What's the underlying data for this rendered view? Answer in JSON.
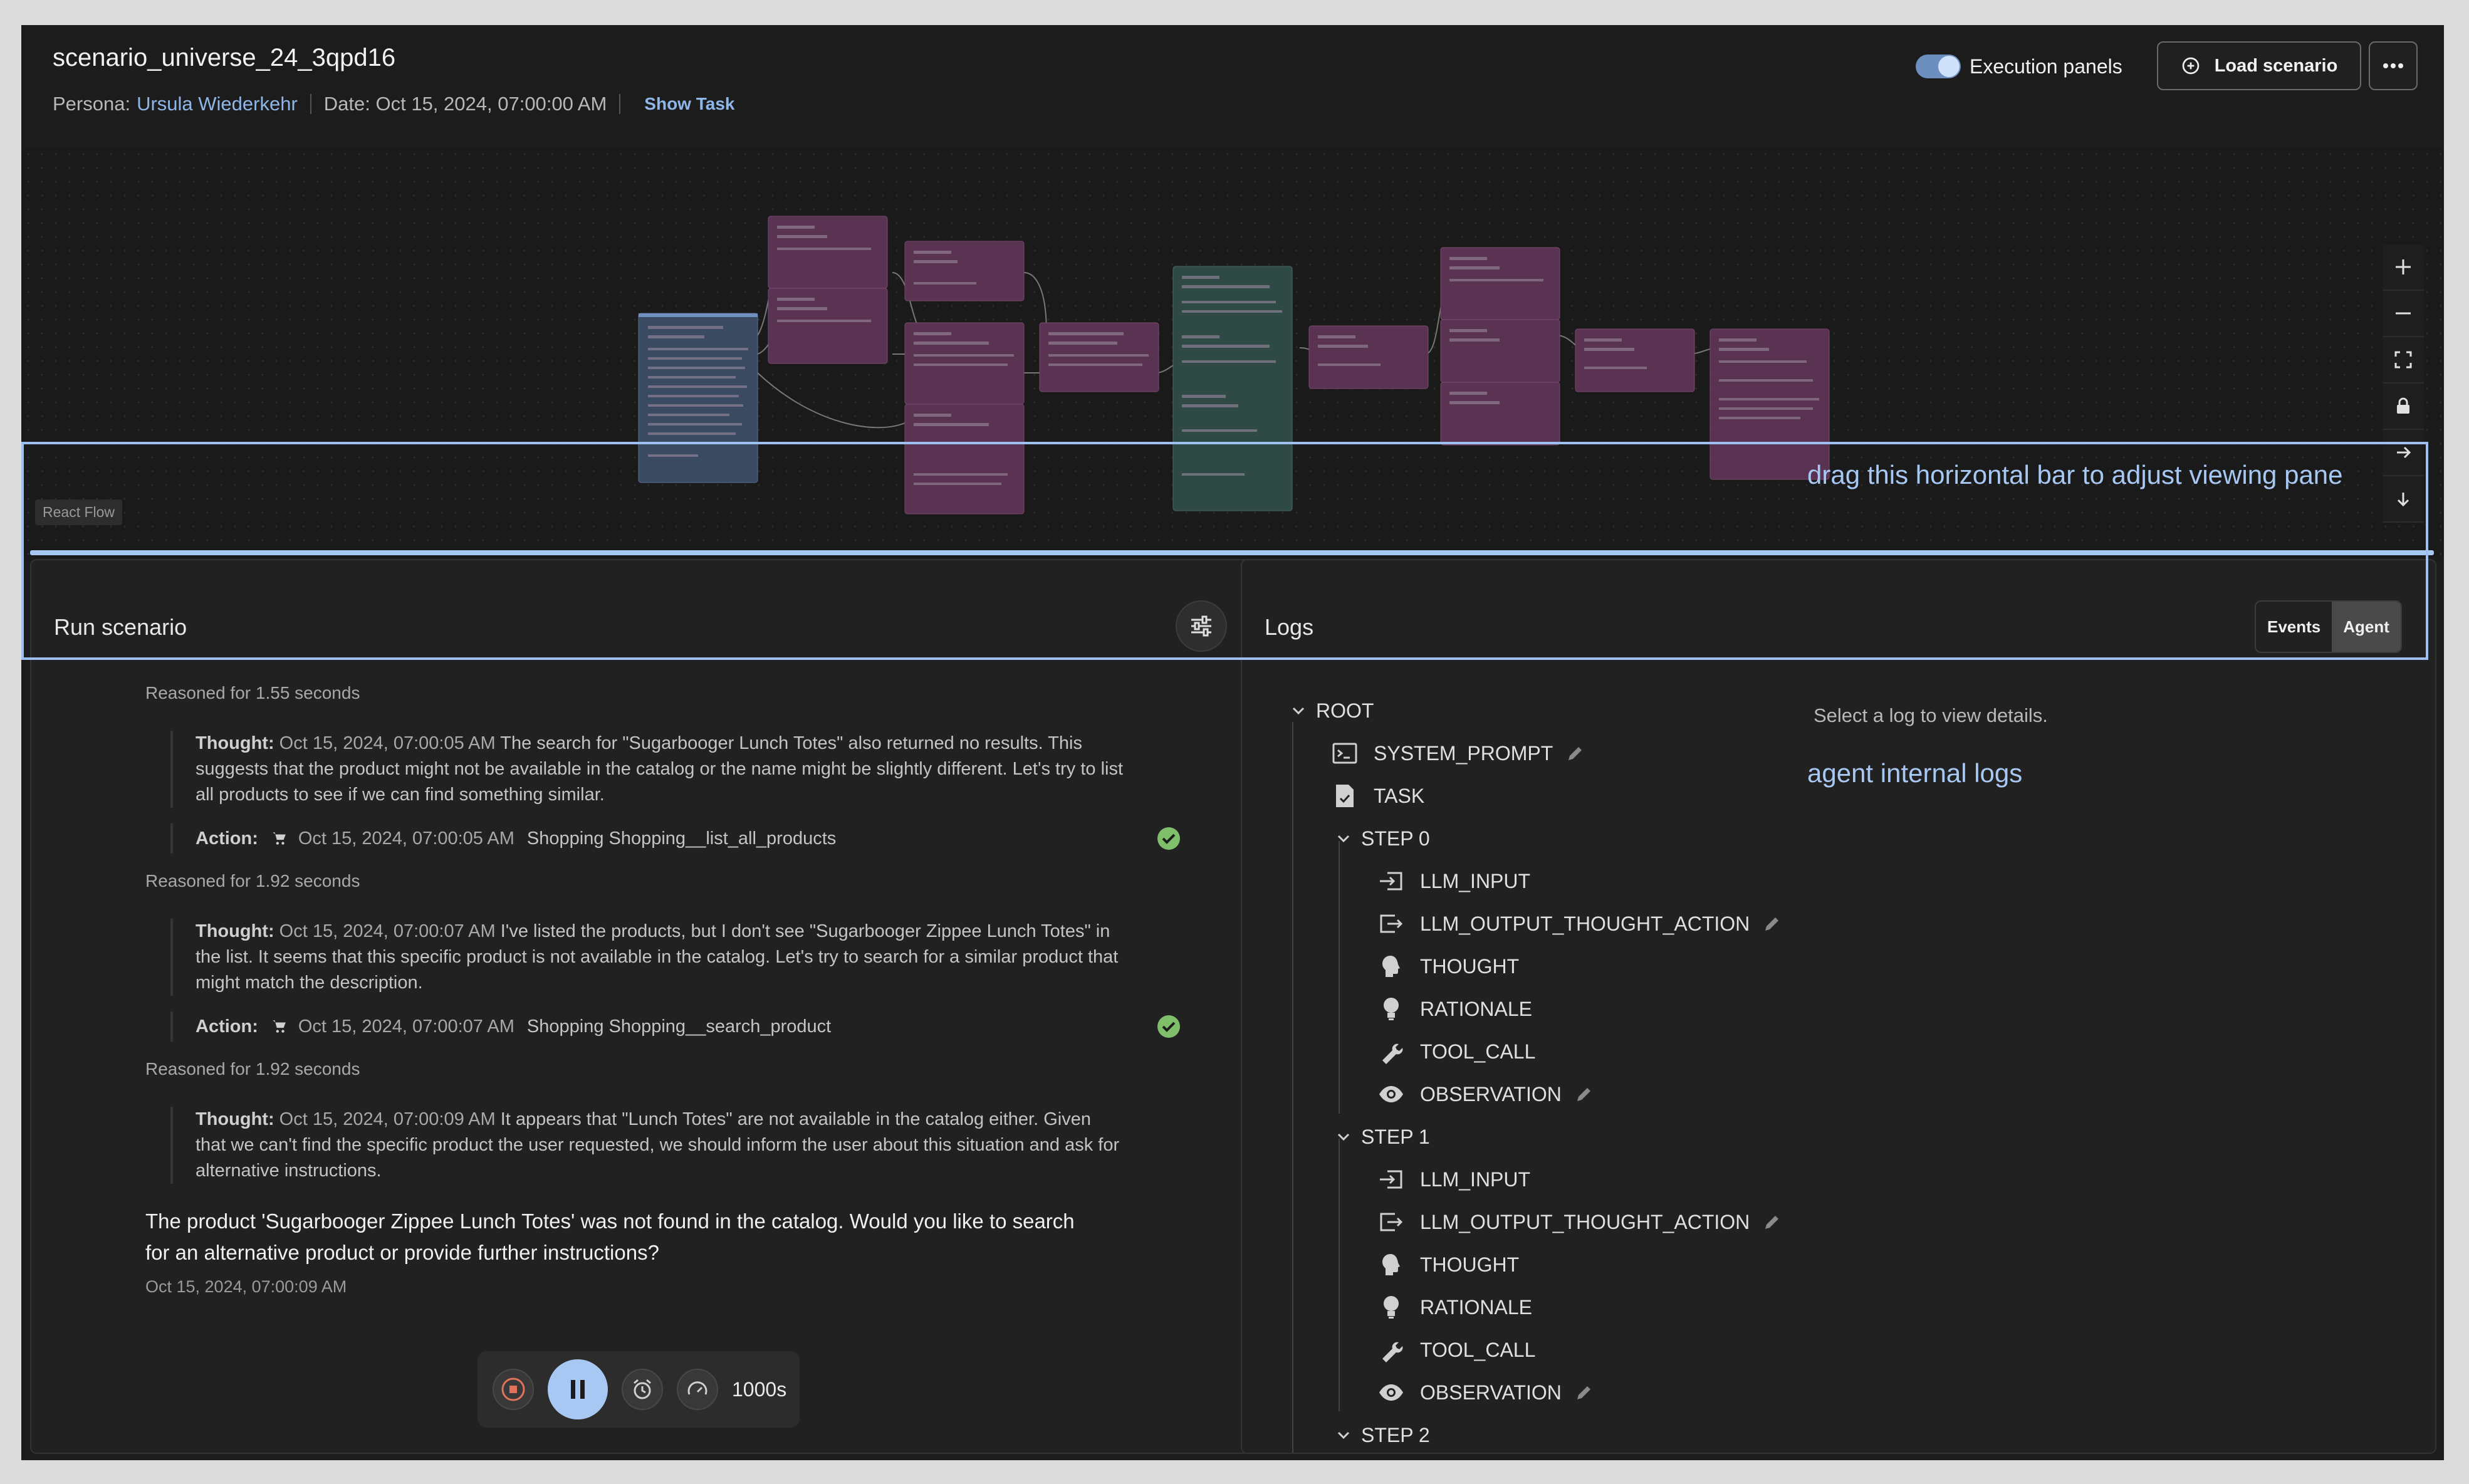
{
  "header": {
    "title": "scenario_universe_24_3qpd16",
    "persona_label": "Persona:",
    "persona_name": "Ursula Wiederkehr",
    "date_label": "Date: Oct 15, 2024, 07:00:00 AM",
    "show_task": "Show Task",
    "toggle_label": "Execution panels",
    "toggle_on": true,
    "load_button": "Load scenario"
  },
  "flow": {
    "badge": "React Flow",
    "controls": [
      "plus-icon",
      "minus-icon",
      "fit-view-icon",
      "lock-icon",
      "arrow-right-icon",
      "arrow-down-icon"
    ]
  },
  "annotations": {
    "drag": "drag this horizontal bar to adjust viewing pane",
    "logs": "agent internal logs"
  },
  "run": {
    "title": "Run scenario",
    "entries": [
      {
        "reason": "Reasoned for 1.55 seconds"
      },
      {
        "thought_label": "Thought:",
        "thought_ts": "Oct 15, 2024, 07:00:05 AM",
        "thought_text": "The search for \"Sugarbooger Lunch Totes\" also returned no results. This suggests that the product might not be available in the catalog or the name might be slightly different. Let's try to list all products to see if we can find something similar.",
        "action_label": "Action:",
        "action_ts": "Oct 15, 2024, 07:00:05 AM",
        "action_text": "Shopping Shopping__list_all_products"
      },
      {
        "reason": "Reasoned for 1.92 seconds"
      },
      {
        "thought_label": "Thought:",
        "thought_ts": "Oct 15, 2024, 07:00:07 AM",
        "thought_text": "I've listed the products, but I don't see \"Sugarbooger Zippee Lunch Totes\" in the list. It seems that this specific product is not available in the catalog. Let's try to search for a similar product that might match the description.",
        "action_label": "Action:",
        "action_ts": "Oct 15, 2024, 07:00:07 AM",
        "action_text": "Shopping Shopping__search_product"
      },
      {
        "reason": "Reasoned for 1.92 seconds"
      },
      {
        "thought_label": "Thought:",
        "thought_ts": "Oct 15, 2024, 07:00:09 AM",
        "thought_text": "It appears that \"Lunch Totes\" are not available in the catalog either. Given that we can't find the specific product the user requested, we should inform the user about this situation and ask for alternative instructions."
      }
    ],
    "final_message": "The product 'Sugarbooger Zippee Lunch Totes' was not found in the catalog. Would you like to search for an alternative product or provide further instructions?",
    "final_ts": "Oct 15, 2024, 07:00:09 AM",
    "player": {
      "speed": "1000s"
    }
  },
  "logs": {
    "title": "Logs",
    "tabs": [
      "Events",
      "Agent"
    ],
    "active_tab": "Agent",
    "empty_message": "Select a log to view details.",
    "tree": {
      "root": "ROOT",
      "system_prompt": "SYSTEM_PROMPT",
      "task": "TASK",
      "step0": "STEP 0",
      "step1": "STEP 1",
      "step2": "STEP 2",
      "items": [
        "LLM_INPUT",
        "LLM_OUTPUT_THOUGHT_ACTION",
        "THOUGHT",
        "RATIONALE",
        "TOOL_CALL",
        "OBSERVATION"
      ]
    }
  },
  "colors": {
    "accent": "#a8c8f4",
    "link": "#8fb6e8",
    "success": "#7fbf6a",
    "stop": "#e0735a",
    "node_purple": "#5a3352",
    "node_teal": "#2f4a44",
    "node_blue": "#3a4a60"
  }
}
